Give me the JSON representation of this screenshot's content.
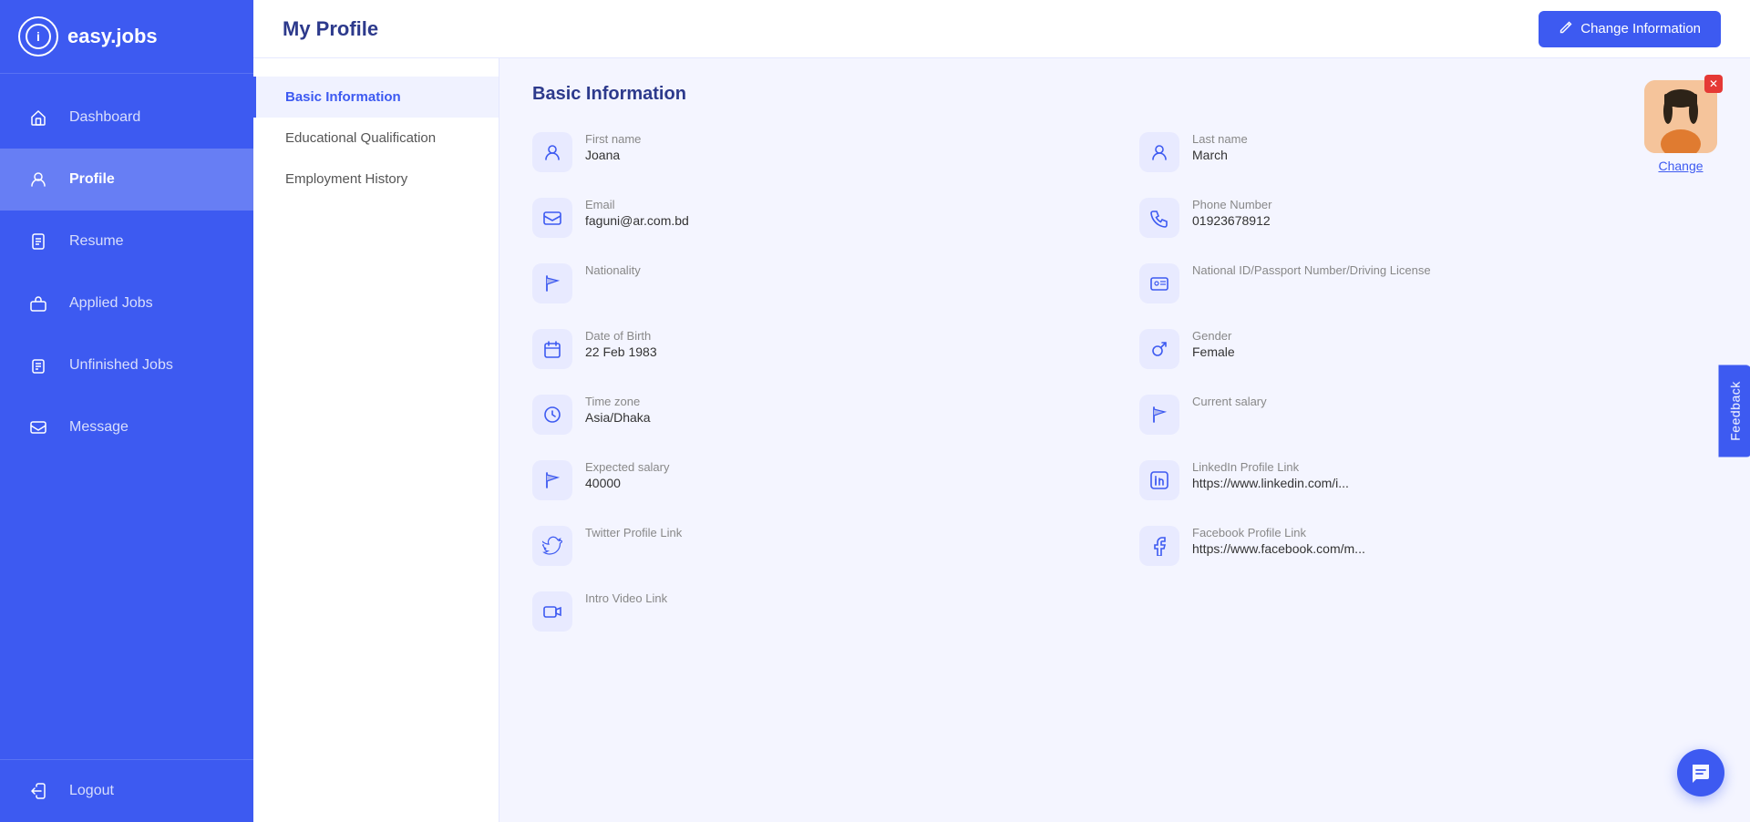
{
  "app": {
    "logo_text": "easy.jobs",
    "logo_icon": "i"
  },
  "sidebar": {
    "nav_items": [
      {
        "id": "dashboard",
        "label": "Dashboard",
        "icon": "⌂",
        "active": false
      },
      {
        "id": "profile",
        "label": "Profile",
        "icon": "👤",
        "active": true
      },
      {
        "id": "resume",
        "label": "Resume",
        "icon": "📄",
        "active": false
      },
      {
        "id": "applied-jobs",
        "label": "Applied Jobs",
        "icon": "💼",
        "active": false
      },
      {
        "id": "unfinished-jobs",
        "label": "Unfinished Jobs",
        "icon": "📋",
        "active": false
      },
      {
        "id": "message",
        "label": "Message",
        "icon": "💬",
        "active": false
      }
    ],
    "logout_label": "Logout",
    "logout_icon": "↩"
  },
  "top_bar": {
    "title": "My Profile",
    "change_info_label": "Change Information",
    "pencil_icon": "✏"
  },
  "profile_nav": {
    "items": [
      {
        "id": "basic-info",
        "label": "Basic Information",
        "active": true
      },
      {
        "id": "educational",
        "label": "Educational Qualification",
        "active": false
      },
      {
        "id": "employment",
        "label": "Employment History",
        "active": false
      }
    ]
  },
  "section_title": "Basic Information",
  "fields": [
    {
      "id": "first-name",
      "label": "First name",
      "value": "Joana",
      "icon": "person"
    },
    {
      "id": "last-name",
      "label": "Last name",
      "value": "March",
      "icon": "person"
    },
    {
      "id": "email",
      "label": "Email",
      "value": "faguni@ar.com.bd",
      "icon": "email"
    },
    {
      "id": "phone",
      "label": "Phone Number",
      "value": "01923678912",
      "icon": "phone"
    },
    {
      "id": "nationality",
      "label": "Nationality",
      "value": "",
      "icon": "flag"
    },
    {
      "id": "national-id",
      "label": "National ID/Passport Number/Driving License",
      "value": "",
      "icon": "id-card"
    },
    {
      "id": "dob",
      "label": "Date of Birth",
      "value": "22 Feb 1983",
      "icon": "calendar"
    },
    {
      "id": "gender",
      "label": "Gender",
      "value": "Female",
      "icon": "gender"
    },
    {
      "id": "timezone",
      "label": "Time zone",
      "value": "Asia/Dhaka",
      "icon": "clock"
    },
    {
      "id": "current-salary",
      "label": "Current salary",
      "value": "",
      "icon": "flag"
    },
    {
      "id": "expected-salary",
      "label": "Expected salary",
      "value": "40000",
      "icon": "flag"
    },
    {
      "id": "linkedin",
      "label": "LinkedIn Profile Link",
      "value": "https://www.linkedin.com/i...",
      "icon": "linkedin"
    },
    {
      "id": "twitter",
      "label": "Twitter Profile Link",
      "value": "",
      "icon": "twitter"
    },
    {
      "id": "facebook",
      "label": "Facebook Profile Link",
      "value": "https://www.facebook.com/m...",
      "icon": "facebook"
    },
    {
      "id": "intro-video",
      "label": "Intro Video Link",
      "value": "",
      "icon": "video"
    }
  ],
  "avatar": {
    "change_label": "Change",
    "badge_icon": "✕"
  },
  "feedback": {
    "label": "Feedback"
  },
  "chat": {
    "icon": "💬"
  }
}
